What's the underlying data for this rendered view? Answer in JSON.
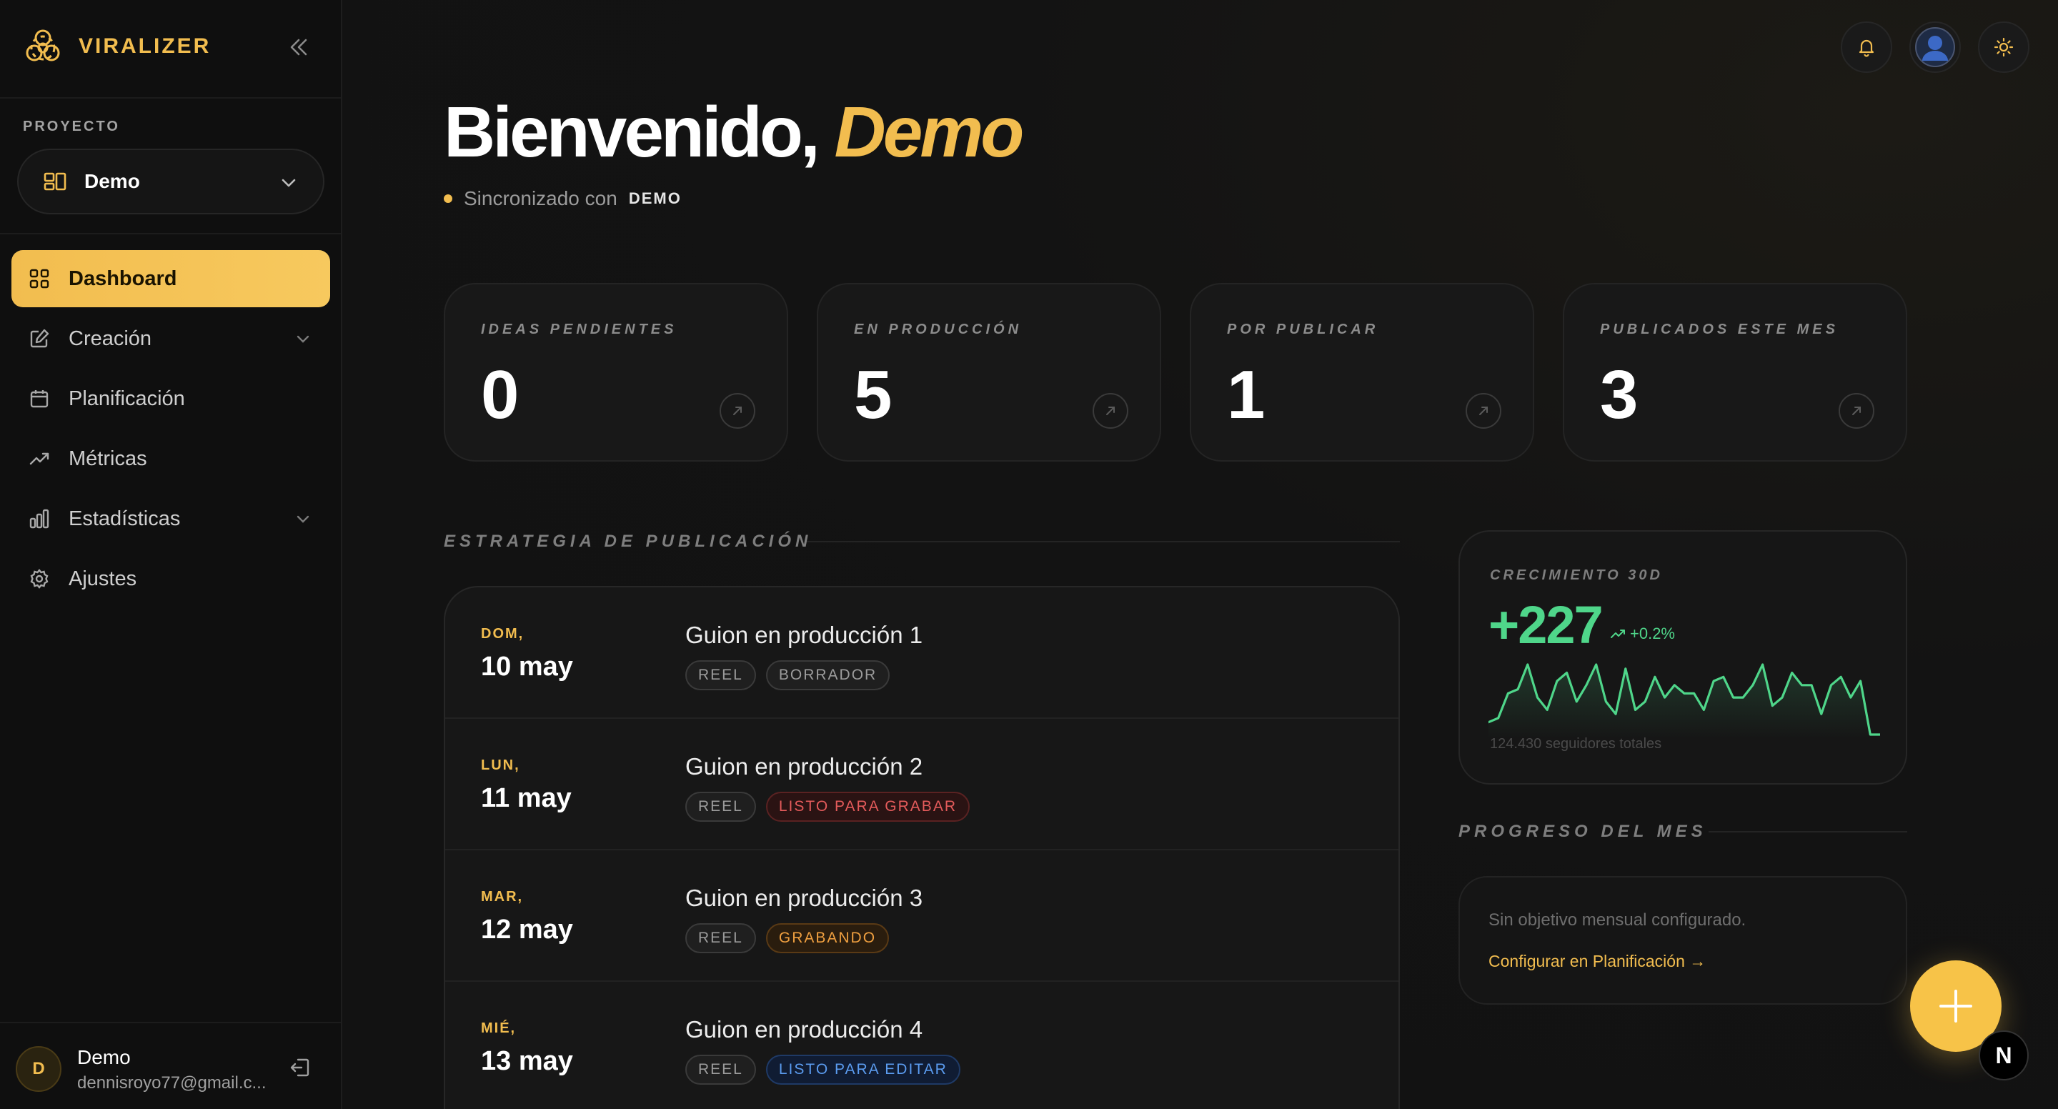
{
  "brand": {
    "name": "VIRALIZER",
    "logo_icon": "biohazard-icon",
    "accent": "#f2bd4f"
  },
  "sidebar": {
    "project_label": "PROYECTO",
    "project_name": "Demo",
    "items": [
      {
        "label": "Dashboard",
        "icon": "grid-icon",
        "active": true
      },
      {
        "label": "Creación",
        "icon": "pencil-icon",
        "expandable": true
      },
      {
        "label": "Planificación",
        "icon": "calendar-icon"
      },
      {
        "label": "Métricas",
        "icon": "trend-up-icon"
      },
      {
        "label": "Estadísticas",
        "icon": "bar-chart-icon",
        "expandable": true
      },
      {
        "label": "Ajustes",
        "icon": "gear-icon"
      }
    ],
    "user": {
      "initial": "D",
      "name": "Demo",
      "email": "dennisroyo77@gmail.c..."
    }
  },
  "header": {
    "welcome_prefix": "Bienvenido, ",
    "welcome_name": "Demo",
    "sync_text": "Sincronizado con",
    "sync_project": "DEMO"
  },
  "kpis": [
    {
      "label": "IDEAS PENDIENTES",
      "value": "0"
    },
    {
      "label": "EN PRODUCCIÓN",
      "value": "5"
    },
    {
      "label": "POR PUBLICAR",
      "value": "1"
    },
    {
      "label": "PUBLICADOS ESTE MES",
      "value": "3"
    }
  ],
  "strategy": {
    "title": "ESTRATEGIA DE PUBLICACIÓN",
    "rows": [
      {
        "day": "DOM,",
        "date": "10 may",
        "title": "Guion en producción 1",
        "tags": [
          {
            "text": "REEL",
            "tone": "neutral"
          },
          {
            "text": "BORRADOR",
            "tone": "neutral"
          }
        ]
      },
      {
        "day": "LUN,",
        "date": "11 may",
        "title": "Guion en producción 2",
        "tags": [
          {
            "text": "REEL",
            "tone": "neutral"
          },
          {
            "text": "LISTO PARA GRABAR",
            "tone": "red"
          }
        ]
      },
      {
        "day": "MAR,",
        "date": "12 may",
        "title": "Guion en producción 3",
        "tags": [
          {
            "text": "REEL",
            "tone": "neutral"
          },
          {
            "text": "GRABANDO",
            "tone": "orange"
          }
        ]
      },
      {
        "day": "MIÉ,",
        "date": "13 may",
        "title": "Guion en producción 4",
        "tags": [
          {
            "text": "REEL",
            "tone": "neutral"
          },
          {
            "text": "LISTO PARA EDITAR",
            "tone": "blue"
          }
        ]
      }
    ]
  },
  "growth": {
    "label": "CRECIMIENTO 30D",
    "value": "+227",
    "delta": "+0.2%",
    "subtitle": "124.430 seguidores totales",
    "color": "#4fd68a",
    "sparkline": [
      12,
      14,
      26,
      28,
      40,
      24,
      18,
      32,
      36,
      22,
      30,
      40,
      22,
      16,
      38,
      18,
      22,
      34,
      24,
      30,
      26,
      26,
      18,
      32,
      34,
      24,
      24,
      30,
      40,
      20,
      24,
      36,
      30,
      30,
      16,
      30,
      34,
      24,
      32,
      6,
      6
    ]
  },
  "progress": {
    "title": "PROGRESO DEL MES",
    "empty_text": "Sin objetivo mensual configurado.",
    "link_text": "Configurar en Planificación →"
  },
  "actions": {
    "fab_icon": "plus-icon",
    "badge": "N"
  }
}
